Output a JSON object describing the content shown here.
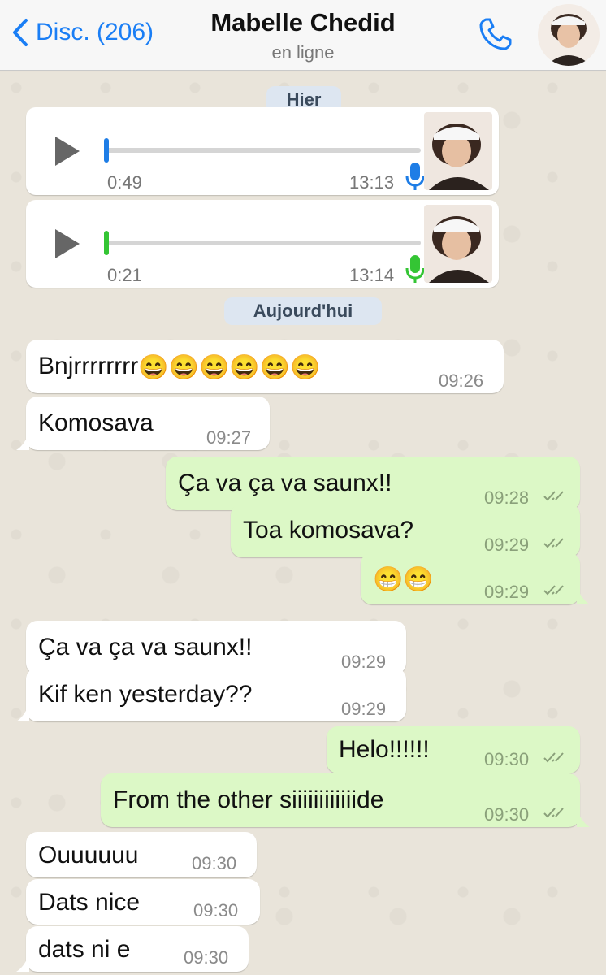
{
  "header": {
    "back_label": "Disc. (206)",
    "contact_name": "Mabelle Chedid",
    "status": "en ligne",
    "call_icon": "phone-icon",
    "avatar": "contact-avatar"
  },
  "dates": {
    "yesterday": "Hier",
    "today": "Aujourd'hui"
  },
  "voice_messages": [
    {
      "duration": "0:49",
      "time": "13:13",
      "state_color": "#1e7de6"
    },
    {
      "duration": "0:21",
      "time": "13:14",
      "state_color": "#34c534"
    }
  ],
  "messages": [
    {
      "text": "Bnjrrrrrrrr",
      "emoji": "😄😄😄😄😄😄",
      "time": "09:26",
      "dir": "in"
    },
    {
      "text": "Komosava",
      "time": "09:27",
      "dir": "in"
    },
    {
      "text": "Ça va ça va saunx!!",
      "time": "09:28",
      "dir": "out"
    },
    {
      "text": "Toa komosava?",
      "time": "09:29",
      "dir": "out"
    },
    {
      "text": "",
      "emoji": "😁😁",
      "time": "09:29",
      "dir": "out"
    },
    {
      "text": "Ça va ça va saunx!!",
      "time": "09:29",
      "dir": "in"
    },
    {
      "text": "Kif ken yesterday??",
      "time": "09:29",
      "dir": "in"
    },
    {
      "text": "Helo!!!!!!",
      "time": "09:30",
      "dir": "out"
    },
    {
      "text": "From the other siiiiiiiiiiiide",
      "time": "09:30",
      "dir": "out"
    },
    {
      "text": "Ouuuuuu",
      "time": "09:30",
      "dir": "in"
    },
    {
      "text": "Dats nice",
      "time": "09:30",
      "dir": "in"
    },
    {
      "text": "dats ni e",
      "time": "09:30",
      "dir": "in"
    }
  ],
  "colors": {
    "accent": "#1a7ef5",
    "incoming_bubble": "#ffffff",
    "outgoing_bubble": "#dcf8c6",
    "date_pill": "#dde6f1"
  }
}
